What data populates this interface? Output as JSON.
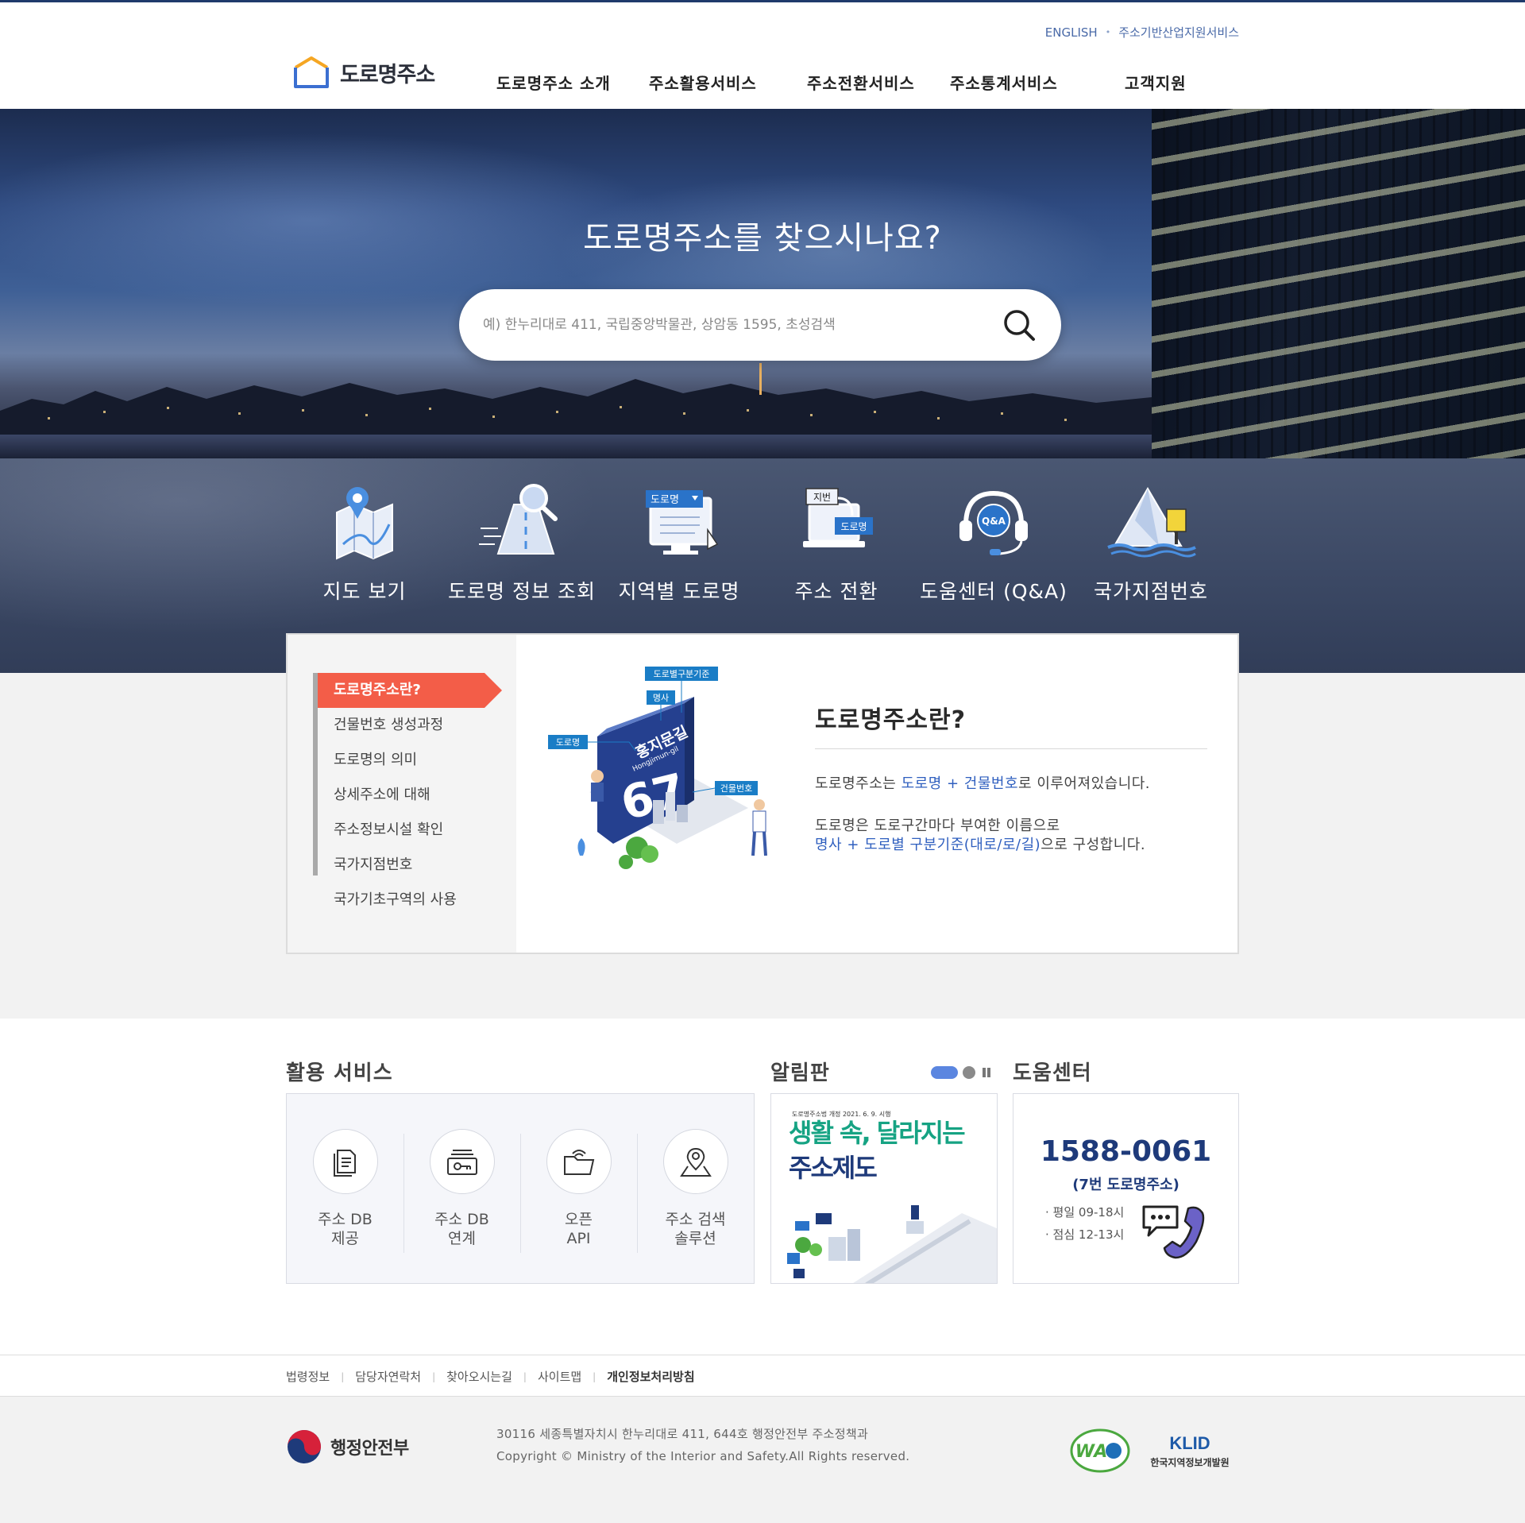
{
  "header": {
    "util_links": [
      "ENGLISH",
      "주소기반산업지원서비스"
    ],
    "logo_text": "도로명주소",
    "nav": [
      "도로명주소 소개",
      "주소활용서비스",
      "주소전환서비스",
      "주소통계서비스",
      "고객지원"
    ]
  },
  "hero": {
    "title": "도로명주소를 찾으시나요?",
    "search_placeholder": "예) 한누리대로 411, 국립중앙박물관, 상암동 1595, 초성검색"
  },
  "quick_menu": [
    {
      "label": "지도 보기",
      "icon": "map-icon"
    },
    {
      "label": "도로명 정보 조회",
      "icon": "road-search-icon"
    },
    {
      "label": "지역별 도로명",
      "icon": "region-road-icon"
    },
    {
      "label": "주소 전환",
      "icon": "address-convert-icon"
    },
    {
      "label": "도움센터 (Q&A)",
      "icon": "headset-icon"
    },
    {
      "label": "국가지점번호",
      "icon": "mountain-sign-icon"
    }
  ],
  "quick_menu_tags": {
    "road": "도로명",
    "lot": "지번",
    "qa": "Q&A"
  },
  "intro": {
    "menu": [
      "도로명주소란?",
      "건물번호 생성과정",
      "도로명의 의미",
      "상세주소에 대해",
      "주소정보시설 확인",
      "국가지점번호",
      "국가기초구역의 사용"
    ],
    "title": "도로명주소란?",
    "line1_a": "도로명주소는 ",
    "line1_b": "도로명 + 건물번호",
    "line1_c": "로 이루어져있습니다.",
    "line2": "도로명은 도로구간마다 부여한 이름으로",
    "line3_a": "명사 + 도로별 구분기준(대로/로/길)",
    "line3_b": "으로 구성합니다.",
    "illust_labels": {
      "criteria": "도로별구분기준",
      "noun": "명사",
      "road": "도로명",
      "building": "건물번호",
      "sign_name": "홍지문길",
      "sign_roman": "Hongjimun-gil",
      "sign_number": "67"
    }
  },
  "services": {
    "title": "활용 서비스",
    "items": [
      {
        "line1": "주소 DB",
        "line2": "제공",
        "icon": "document-icon"
      },
      {
        "line1": "주소 DB",
        "line2": "연계",
        "icon": "db-link-icon"
      },
      {
        "line1": "오픈",
        "line2": "API",
        "icon": "folder-wifi-icon"
      },
      {
        "line1": "주소 검색",
        "line2": "솔루션",
        "icon": "map-pin-icon"
      }
    ]
  },
  "notice": {
    "title": "알림판",
    "banner_small": "도로명주소법 개정 2021. 6. 9. 시행",
    "banner_line1": "생활 속, 달라지는",
    "banner_line2": "주소제도"
  },
  "help": {
    "title": "도움센터",
    "phone": "1588-0061",
    "sub": "(7번 도로명주소)",
    "hours1": "평일 09-18시",
    "hours2": "점심 12-13시"
  },
  "footer": {
    "links": [
      "법령정보",
      "담당자연락처",
      "찾아오시는길",
      "사이트맵",
      "개인정보처리방침"
    ],
    "org": "행정안전부",
    "address": "30116 세종특별자치시 한누리대로 411, 644호 행정안전부 주소정책과",
    "copyright": "Copyright © Ministry of the Interior and Safety.All Rights reserved.",
    "badge_wa": "WA",
    "badge_klid": "KLID",
    "badge_klid_sub": "한국지역정보개발원"
  },
  "colors": {
    "accent_red": "#f35d48",
    "brand_navy": "#1e3a7a",
    "link_blue": "#2f5fbf"
  }
}
